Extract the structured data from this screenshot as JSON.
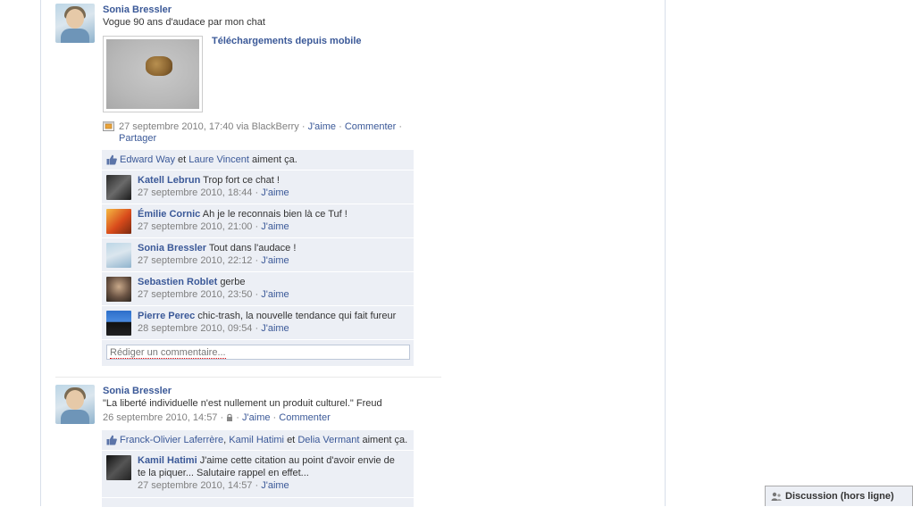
{
  "story1": {
    "actor": "Sonia Bressler",
    "message": "Vogue 90 ans d'audace par mon chat",
    "attachment_title": "Téléchargements depuis mobile",
    "meta": {
      "time": "27 septembre 2010, 17:40 via BlackBerry",
      "like": "J'aime",
      "comment": "Commenter",
      "share": "Partager"
    },
    "likes": {
      "person1": "Edward Way",
      "conj": "et",
      "person2": "Laure Vincent",
      "suffix": "aiment ça."
    },
    "comments": [
      {
        "author": "Katell Lebrun",
        "text": "Trop fort ce chat !",
        "time": "27 septembre 2010, 18:44",
        "like": "J'aime"
      },
      {
        "author": "Émilie Cornic",
        "text": "Ah je le reconnais bien là ce Tuf !",
        "time": "27 septembre 2010, 21:00",
        "like": "J'aime"
      },
      {
        "author": "Sonia Bressler",
        "text": "Tout dans l'audace !",
        "time": "27 septembre 2010, 22:12",
        "like": "J'aime"
      },
      {
        "author": "Sebastien Roblet",
        "text": "gerbe",
        "time": "27 septembre 2010, 23:50",
        "like": "J'aime"
      },
      {
        "author": "Pierre Perec",
        "text": "chic-trash, la nouvelle tendance qui fait fureur",
        "time": "28 septembre 2010, 09:54",
        "like": "J'aime"
      }
    ],
    "comment_placeholder": "Rédiger un commentaire..."
  },
  "story2": {
    "actor": "Sonia Bressler",
    "message": "\"La liberté individuelle n'est nullement un produit culturel.\" Freud",
    "meta": {
      "time": "26 septembre 2010, 14:57",
      "like": "J'aime",
      "comment": "Commenter"
    },
    "likes": {
      "person1": "Franck-Olivier Laferrère",
      "sep": ",",
      "person2": "Kamil Hatimi",
      "conj": "et",
      "person3": "Delia Vermant",
      "suffix": "aiment ça."
    },
    "comments": [
      {
        "author": "Kamil Hatimi",
        "text": "J'aime cette citation au point d'avoir envie de te la piquer... Salutaire rappel en effet...",
        "time": "27 septembre 2010, 14:57",
        "like": "J'aime"
      }
    ]
  },
  "chat": {
    "label": "Discussion (hors ligne)"
  },
  "icons": {
    "mobile_upload": "mobile-upload-icon",
    "like_thumb": "thumbs-up-icon",
    "lock": "lock-icon",
    "chat": "chat-users-icon"
  },
  "colors": {
    "link": "#3b5998",
    "feedback_bg": "#eceff5",
    "meta_text": "#808080"
  }
}
